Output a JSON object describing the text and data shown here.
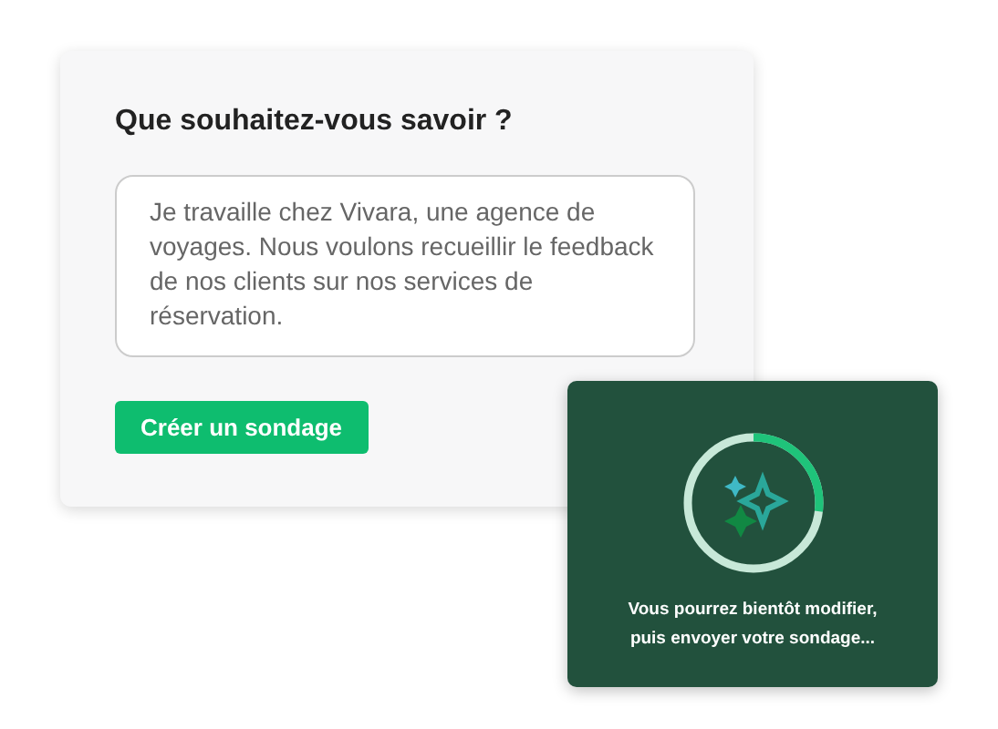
{
  "prompt_card": {
    "heading": "Que souhaitez-vous savoir ?",
    "description_field": {
      "value": "Je travaille chez Vivara, une agence de voyages. Nous voulons recueillir le feedback de nos clients sur nos services de réservation."
    },
    "create_button": "Créer un sondage"
  },
  "progress_panel": {
    "level": 0.27,
    "message": "Vous pourrez bientôt modifier, puis envoyer votre sondage..."
  }
}
